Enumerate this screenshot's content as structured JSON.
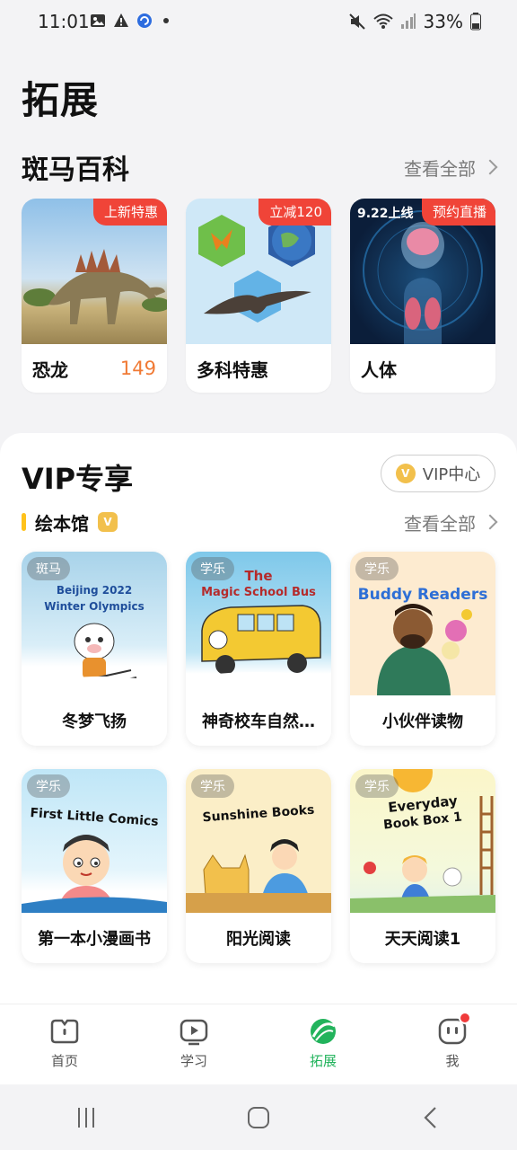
{
  "status_bar": {
    "time": "11:01",
    "battery": "33%"
  },
  "page": {
    "title": "拓展"
  },
  "encyclopedia": {
    "title": "斑马百科",
    "see_all": "查看全部",
    "cards": [
      {
        "name": "恐龙",
        "tag": "上新特惠",
        "price": "149"
      },
      {
        "name": "多科特惠",
        "tag": "立减120"
      },
      {
        "name": "人体",
        "tag": "预约直播",
        "date_badge": "9.22上线"
      }
    ]
  },
  "vip": {
    "title": "VIP专享",
    "center_label": "VIP中心",
    "coin_letter": "V",
    "library": {
      "title": "绘本馆",
      "badge_letter": "V",
      "see_all": "查看全部",
      "books": [
        {
          "title": "冬梦飞扬",
          "tag": "斑马",
          "cover_line1": "Beijing 2022",
          "cover_line2": "Winter Olympics"
        },
        {
          "title": "神奇校车自然…",
          "tag": "学乐",
          "cover_line1": "The",
          "cover_line2": "Magic School Bus"
        },
        {
          "title": "小伙伴读物",
          "tag": "学乐",
          "cover_line1": "Buddy Readers"
        },
        {
          "title": "第一本小漫画书",
          "tag": "学乐",
          "cover_line1": "First Little Comics"
        },
        {
          "title": "阳光阅读",
          "tag": "学乐",
          "cover_line1": "Sunshine Books"
        },
        {
          "title": "天天阅读1",
          "tag": "学乐",
          "cover_line1": "Everyday",
          "cover_line2": "Book Box 1"
        }
      ]
    }
  },
  "bottom_nav": {
    "items": [
      {
        "label": "首页",
        "icon": "home-icon"
      },
      {
        "label": "学习",
        "icon": "study-icon"
      },
      {
        "label": "拓展",
        "icon": "explore-icon",
        "active": true
      },
      {
        "label": "我",
        "icon": "profile-icon",
        "has_notification": true
      }
    ]
  },
  "colors": {
    "accent": "#22b35c",
    "tag_red": "#f04438",
    "price": "#f07a35",
    "vip_gold": "#f2c04c"
  }
}
